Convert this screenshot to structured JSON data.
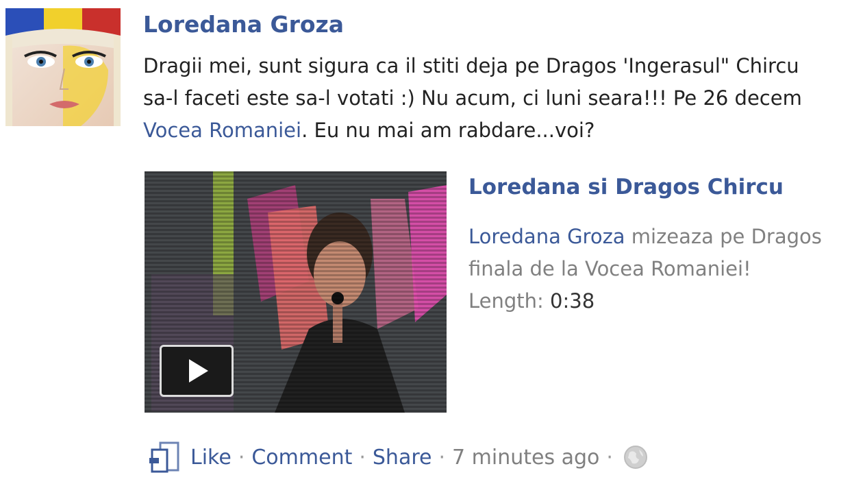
{
  "post": {
    "author": "Loredana Groza",
    "message_lines": [
      "Dragii mei, sunt sigura ca il stiti deja pe Dragos 'Ingerasul\" Chircu",
      "sa-l faceti este sa-l votati :) Nu acum, ci luni seara!!! Pe 26 decem",
      "Vocea Romaniei",
      ". Eu nu mai am rabdare...voi?"
    ]
  },
  "attachment": {
    "title": "Loredana si Dragos Chircu",
    "desc_author": "Loredana Groza",
    "desc_line1": " mizeaza pe Dragos",
    "desc_line2": "finala de la Vocea Romaniei!",
    "length_label": "Length: ",
    "length_value": "0:38",
    "play_icon": "play-icon"
  },
  "actions": {
    "like": "Like",
    "comment": "Comment",
    "share": "Share",
    "timestamp": "7 minutes ago",
    "separator": "·",
    "like_icon": "like-icon",
    "privacy_icon": "globe-icon"
  },
  "colors": {
    "link": "#3b5998",
    "body_text": "#222222",
    "muted_text": "#808080"
  }
}
